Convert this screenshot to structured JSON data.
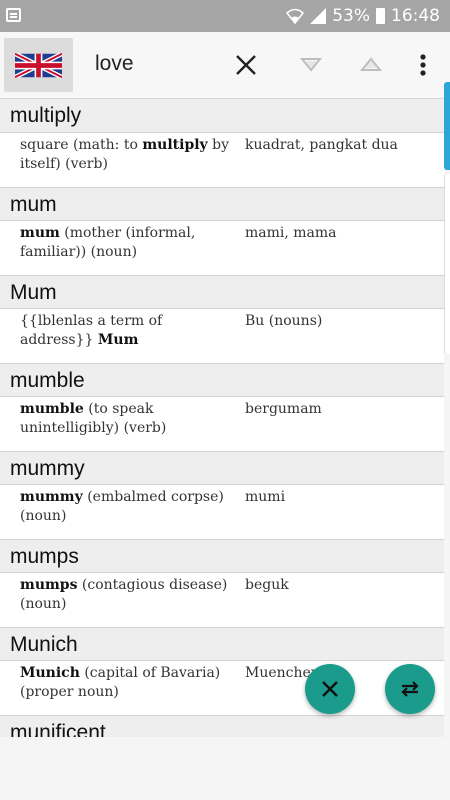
{
  "status": {
    "battery": "53%",
    "time": "16:48"
  },
  "toolbar": {
    "language_flag": "uk-flag",
    "search_value": "love"
  },
  "entries": [
    {
      "word": "multiply",
      "def_bold": "multiply",
      "def_html": "square (math: to <b>multiply</b> by itself) (verb)",
      "translation": "kuadrat, pangkat dua"
    },
    {
      "word": "mum",
      "def_html": "<b>mum</b> (mother (informal, familiar)) (noun)",
      "translation": "mami, mama"
    },
    {
      "word": "Mum",
      "def_html": "{{lblenlas a term of address}} <b>Mum</b>",
      "translation": "Bu (nouns)"
    },
    {
      "word": "mumble",
      "def_html": "<b>mumble</b> (to speak unintelligibly) (verb)",
      "translation": "bergumam"
    },
    {
      "word": "mummy",
      "def_html": "<b>mummy</b> (embalmed corpse) (noun)",
      "translation": "mumi"
    },
    {
      "word": "mumps",
      "def_html": "<b>mumps</b> (contagious disease) (noun)",
      "translation": "beguk"
    },
    {
      "word": "Munich",
      "def_html": "<b>Munich</b> (capital of Bavaria) (proper noun)",
      "translation": "Muenchen"
    },
    {
      "word": "munificent",
      "def_html": "",
      "translation": ""
    }
  ],
  "colors": {
    "accent": "#1a9b8c",
    "scroll_accent": "#2aa7d7"
  }
}
